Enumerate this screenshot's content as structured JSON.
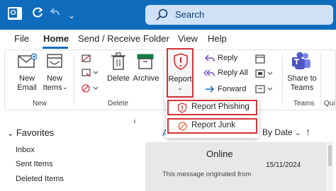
{
  "titlebar": {
    "search_placeholder": "Search",
    "accent": "#0f6cbd"
  },
  "menu": {
    "tabs": [
      "File",
      "Home",
      "Send / Receive",
      "Folder",
      "View",
      "Help"
    ],
    "active": "Home"
  },
  "ribbon": {
    "new_email": "New\nEmail",
    "new_email_l1": "New",
    "new_email_l2": "Email",
    "new_items_l1": "New",
    "new_items_l2": "Items",
    "delete": "Delete",
    "archive": "Archive",
    "report": "Report",
    "reply": "Reply",
    "reply_all": "Reply All",
    "forward": "Forward",
    "share_l1": "Share to",
    "share_l2": "Teams",
    "group_new": "New",
    "group_delete": "Delete",
    "group_teams": "Teams",
    "group_partial": "Qui"
  },
  "report_menu": {
    "phishing": "Report Phishing",
    "junk": "Report Junk",
    "highlight": "#d13438"
  },
  "folders": {
    "favorites": "Favorites",
    "items": [
      "Inbox",
      "Sent Items",
      "Deleted Items"
    ]
  },
  "maillist": {
    "sort_label": "By Date",
    "tab_partial": "A",
    "sender": "Online",
    "date": "15/11/2024",
    "preview": "This message originated from"
  }
}
